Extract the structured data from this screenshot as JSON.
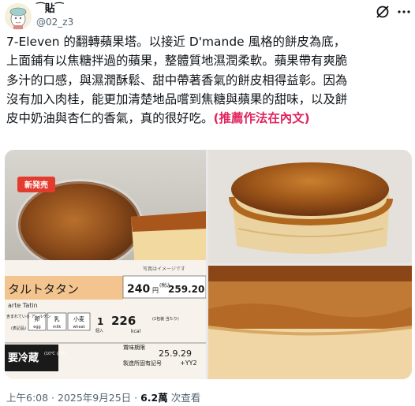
{
  "user": {
    "name": "⁀貼⁀",
    "handle": "@02_z3",
    "avatar_icon": "cartoon-avatar-icon"
  },
  "header_icons": {
    "grok": "grok-icon",
    "more": "more-options-icon"
  },
  "post": {
    "line1": "7-Eleven 的翻轉蘋果塔。以接近 D'mande 風格的餅皮為底，",
    "line2": "上面鋪有以焦糖拌過的蘋果，整體質地濕潤柔軟。蘋果帶有爽脆",
    "line3": "多汁的口感，與濕潤酥鬆、甜中帶著香氣的餅皮相得益彰。因為",
    "line4": "沒有加入肉桂，能更加清楚地品嚐到焦糖與蘋果的甜味，以及餅",
    "line5_text": "皮中奶油與杏仁的香氣，真的很好吃。",
    "line5_link": "(推薦作法在內文)"
  },
  "package": {
    "badge": "新発売",
    "photo_note": "写真はイメージです",
    "product_jp": "タルトタタン",
    "product_fr": "arte Tatin",
    "price": "240",
    "price_unit": "円",
    "price_tax_label": "(税込",
    "price_taxed": "259.20",
    "allergen_label": "含まれている アレルゲン",
    "allergen_sub": "(表記品)",
    "allergens": [
      {
        "jp": "卵",
        "en": "egg"
      },
      {
        "jp": "乳",
        "en": "milk"
      },
      {
        "jp": "小麦",
        "en": "wheat"
      }
    ],
    "count": "1",
    "count_unit": "個入",
    "kcal": "226",
    "kcal_unit": "kcal",
    "kcal_note": "(1包装 当たり)",
    "fridge": "要冷蔵",
    "fridge_temp": "(10℃ 以下)",
    "expiry_label": "賞味期限",
    "expiry": "25.9.29",
    "maker_label": "製造所固有記号",
    "maker_code": "+YY2"
  },
  "footer": {
    "time": "上午6:08",
    "sep": " · ",
    "date": "2025年9月25日",
    "sep2": " · ",
    "views": "6.2萬",
    "views_label": " 次查看"
  },
  "colors": {
    "link": "#e0245e",
    "secondary": "#536471",
    "badge": "#e33b2e",
    "price_bar": "#f5c89a"
  }
}
